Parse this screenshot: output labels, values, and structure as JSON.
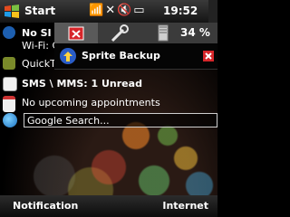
{
  "status_bar": {
    "start_label": "Start",
    "time": "19:52",
    "icons": [
      "signal-icon",
      "no-connection-icon",
      "speaker-off-icon",
      "battery-icon"
    ]
  },
  "home": {
    "items": [
      {
        "icon": "wireless-icon",
        "line1": "No SI",
        "line2": "Wi-Fi: C"
      },
      {
        "icon": "quicktext-icon",
        "text": "QuickT"
      },
      {
        "icon": "messaging-icon",
        "text": "SMS \\ MMS: 1 Unread"
      },
      {
        "icon": "calendar-icon",
        "text": "No upcoming appointments"
      }
    ],
    "search_placeholder": "Google Search..."
  },
  "panel": {
    "battery_percent": "34 %",
    "notification_title": "Sprite Backup"
  },
  "softkeys": {
    "left": "Notification",
    "right": "Internet"
  }
}
